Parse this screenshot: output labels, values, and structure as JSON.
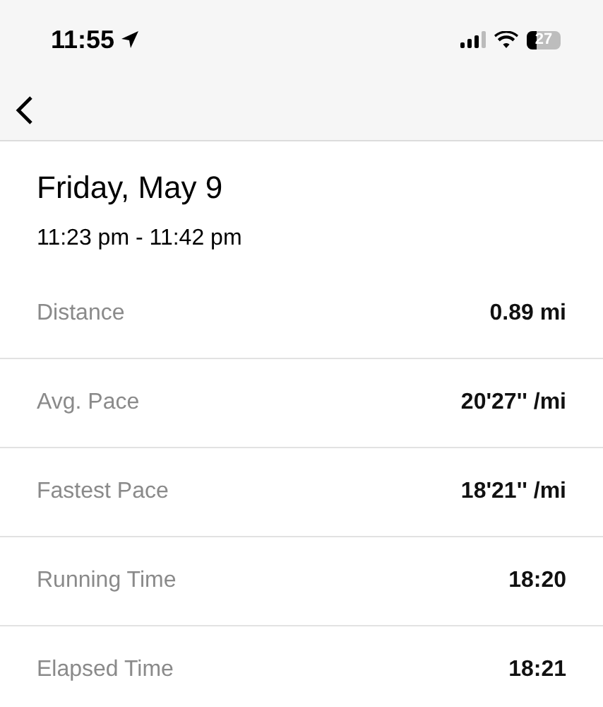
{
  "status_bar": {
    "time": "11:55",
    "battery": "27"
  },
  "header": {
    "title": "Friday, May 9",
    "time_range": "11:23 pm - 11:42 pm"
  },
  "stats": [
    {
      "label": "Distance",
      "value": "0.89 mi"
    },
    {
      "label": "Avg. Pace",
      "value": "20'27'' /mi"
    },
    {
      "label": "Fastest Pace",
      "value": "18'21'' /mi"
    },
    {
      "label": "Running Time",
      "value": "18:20"
    },
    {
      "label": "Elapsed Time",
      "value": "18:21"
    }
  ]
}
